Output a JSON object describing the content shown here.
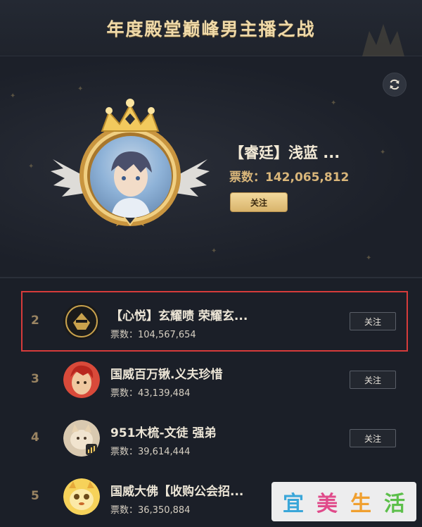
{
  "header": {
    "title": "年度殿堂巅峰男主播之战"
  },
  "top": {
    "name": "【睿廷】浅蓝 ...",
    "votes": "票数：142,065,812",
    "follow_label": "关注"
  },
  "list": [
    {
      "rank": "2",
      "name": "【心悦】玄耀啧 荣耀玄...",
      "votes": "票数：104,567,654",
      "follow_label": "关注"
    },
    {
      "rank": "3",
      "name": "国威百万锹.义夫珍惜",
      "votes": "票数：43,139,484",
      "follow_label": "关注"
    },
    {
      "rank": "4",
      "name": "951木梳-文徒 强弟",
      "votes": "票数：39,614,444",
      "follow_label": "关注"
    },
    {
      "rank": "5",
      "name": "国威大佛【收购公会招...",
      "votes": "票数：36,350,884"
    }
  ],
  "watermark": {
    "chars": [
      "宜",
      "美",
      "生",
      "活"
    ]
  },
  "colors": {
    "background": "#1b1f28",
    "gold": "#d9b67a",
    "highlight": "#d63b3b"
  }
}
